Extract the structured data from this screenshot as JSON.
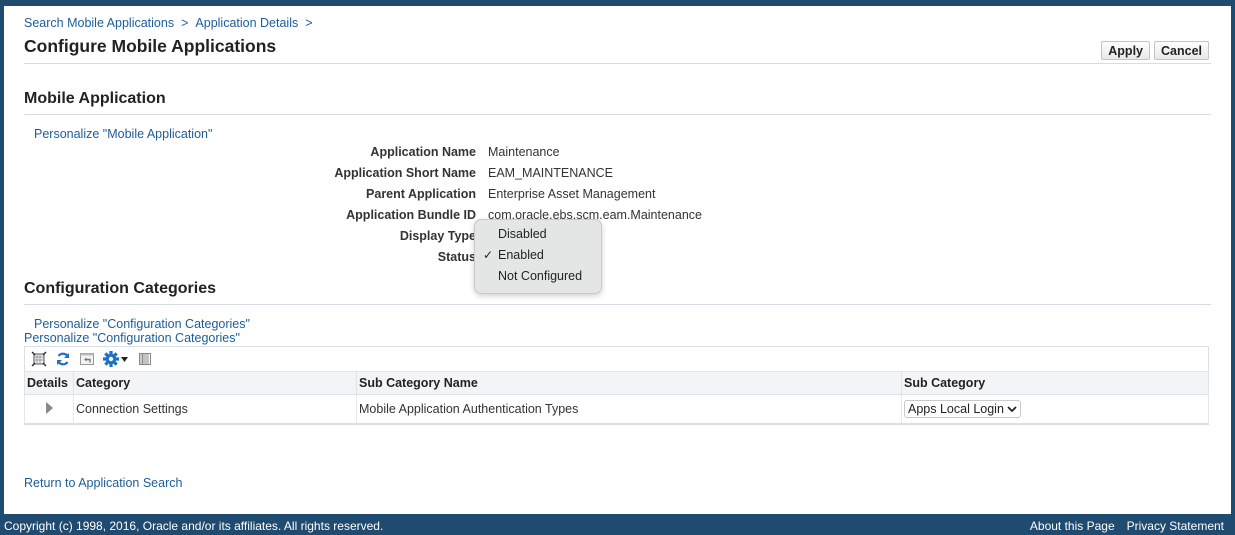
{
  "breadcrumb": [
    {
      "label": "Search Mobile Applications"
    },
    {
      "label": "Application Details"
    }
  ],
  "breadcrumb_separator": ">",
  "page_title": "Configure Mobile Applications",
  "actions": {
    "apply_label": "Apply",
    "cancel_label": "Cancel"
  },
  "mobile_application": {
    "heading": "Mobile Application",
    "personalize_link": "Personalize \"Mobile Application\"",
    "fields": [
      {
        "label": "Application Name",
        "value": "Maintenance"
      },
      {
        "label": "Application Short Name",
        "value": "EAM_MAINTENANCE"
      },
      {
        "label": "Parent Application",
        "value": "Enterprise Asset Management"
      },
      {
        "label": "Application Bundle ID",
        "value": "com.oracle.ebs.scm.eam.Maintenance"
      },
      {
        "label": "Display Type",
        "value": ""
      },
      {
        "label": "Status",
        "value": ""
      }
    ],
    "status_dropdown": {
      "options": [
        "Disabled",
        "Enabled",
        "Not Configured"
      ],
      "selected": "Enabled",
      "check_glyph": "✓"
    }
  },
  "configuration_categories": {
    "heading": "Configuration Categories",
    "personalize_links": [
      "Personalize \"Configuration Categories\"",
      "Personalize \"Configuration Categories\""
    ],
    "toolbar_icons": [
      "detach-icon",
      "refresh-icon",
      "restore-icon",
      "settings-gear-icon",
      "freeze-columns-icon"
    ],
    "columns": [
      "Details",
      "Category",
      "Sub Category Name",
      "Sub Category"
    ],
    "rows": [
      {
        "category": "Connection Settings",
        "sub_category_name": "Mobile Application Authentication Types",
        "sub_category": "Apps Local Login"
      }
    ]
  },
  "return_link": "Return to Application Search",
  "footer": {
    "copyright": "Copyright (c) 1998, 2016, Oracle and/or its affiliates. All rights reserved.",
    "about": "About this Page",
    "privacy": "Privacy Statement"
  },
  "colors": {
    "brand_frame": "#1f4b70",
    "link": "#1d5d9a"
  }
}
